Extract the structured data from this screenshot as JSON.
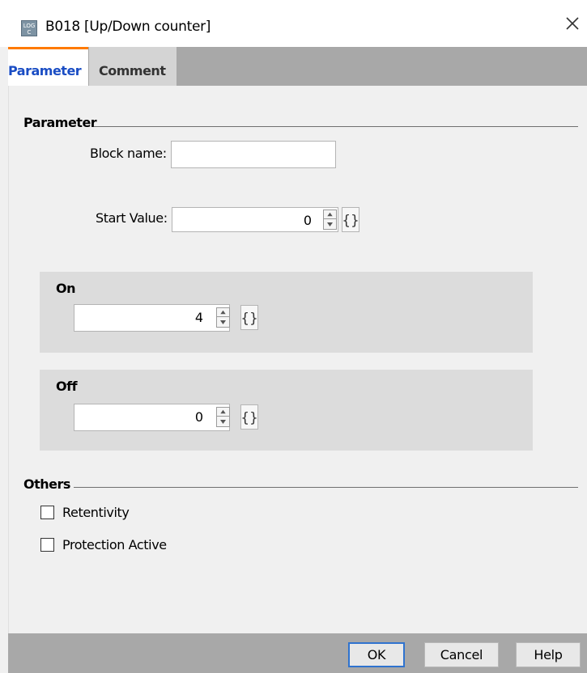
{
  "window": {
    "title": "B018 [Up/Down counter]",
    "icon": "logo-block-icon",
    "close_icon": "close-icon"
  },
  "tabs": [
    {
      "label": "Parameter",
      "active": true
    },
    {
      "label": "Comment",
      "active": false
    }
  ],
  "parameter": {
    "section_title": "Parameter",
    "block_name_label": "Block name:",
    "block_name_value": "",
    "start_value_label": "Start Value:",
    "start_value": "0",
    "on_group": {
      "title": "On",
      "value": "4"
    },
    "off_group": {
      "title": "Off",
      "value": "0"
    },
    "brace_symbol": "{}"
  },
  "others": {
    "section_title": "Others",
    "retentivity_label": "Retentivity",
    "retentivity_checked": false,
    "protection_label": "Protection Active",
    "protection_checked": false
  },
  "footer": {
    "ok_label": "OK",
    "cancel_label": "Cancel",
    "help_label": "Help"
  },
  "colors": {
    "active_tab_accent": "#ff7a00",
    "active_tab_text": "#1a4dc4",
    "ok_border": "#2f73cf"
  }
}
